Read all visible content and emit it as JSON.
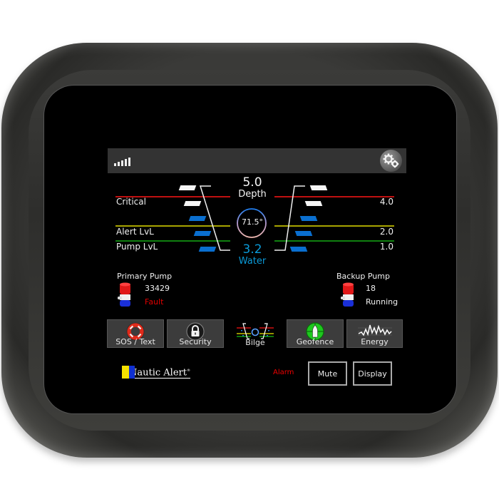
{
  "device": {
    "brand": "Nautic Alert",
    "brand_mark": "®"
  },
  "header": {
    "signal_icon": "signal-strength-icon",
    "signal_bars": 5,
    "signal_level": "5/5",
    "settings_icon": "gears-icon"
  },
  "bilge": {
    "depth_value": "5.0",
    "depth_label": "Depth",
    "temperature": "71.5°",
    "water_value": "3.2",
    "water_label": "Water",
    "levels": [
      {
        "name": "Critical",
        "value": "4.0",
        "color": "#cc1010"
      },
      {
        "name": "Alert LvL",
        "value": "2.0",
        "color": "#b8b400"
      },
      {
        "name": "Pump LvL",
        "value": "1.0",
        "color": "#109010"
      }
    ],
    "gauge_segments": {
      "total": 5,
      "filled_dry": 2,
      "filled_water": 3,
      "dry_color": "#f5f5f5",
      "water_color": "#0a6fd0"
    }
  },
  "pumps": {
    "primary": {
      "title": "Primary Pump",
      "count": "33429",
      "status": "Fault",
      "status_color": "#e00000"
    },
    "backup": {
      "title": "Backup Pump",
      "count": "18",
      "status": "Running",
      "status_color": "#f0f0f0"
    }
  },
  "nav": [
    {
      "id": "sos",
      "label": "SOS / Text",
      "icon": "life-ring-icon"
    },
    {
      "id": "security",
      "label": "Security",
      "icon": "padlock-icon"
    },
    {
      "id": "bilge",
      "label": "Bilge",
      "icon": "bilge-gauge-icon",
      "active": true
    },
    {
      "id": "geofence",
      "label": "Geofence",
      "icon": "boat-crosshair-icon"
    },
    {
      "id": "energy",
      "label": "Energy",
      "icon": "waveform-icon"
    }
  ],
  "footer": {
    "alarm_label": "Alarm",
    "mute_label": "Mute",
    "display_label": "Display"
  },
  "colors": {
    "accent_blue": "#0a9ad8",
    "fault_red": "#e00000"
  }
}
